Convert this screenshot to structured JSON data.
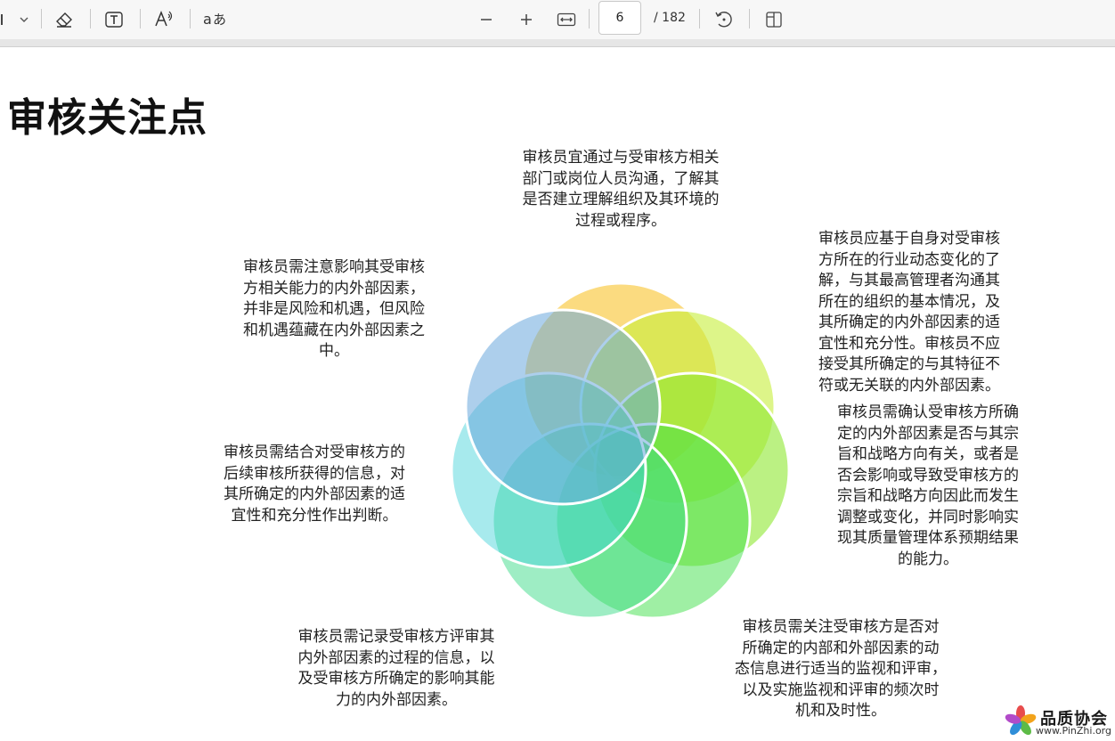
{
  "toolbar": {
    "current_page": "6",
    "total_pages": "/ 182",
    "tools": [
      "draw-dropdown",
      "eraser",
      "text-box",
      "read-aloud",
      "text-options",
      "zoom-out",
      "zoom-in",
      "fit-width",
      "rotate",
      "page-view"
    ]
  },
  "slide": {
    "title": "审核关注点",
    "notes": {
      "top": [
        "审核员宜通过与受审核方相关",
        "部门或岗位人员沟通，了解其",
        "是否建立理解组织及其环境的",
        "过程或程序。"
      ],
      "upper_right": [
        "审核员应基于自身对受审核",
        "方所在的行业动态变化的了",
        "解，与其最高管理者沟通其",
        "所在的组织的基本情况，及",
        "其所确定的内外部因素的适",
        "宜性和充分性。审核员不应",
        "接受其所确定的与其特征不",
        "符或无关联的内外部因素。"
      ],
      "right": [
        "审核员需确认受审核方所确",
        "定的内外部因素是否与其宗",
        "旨和战略方向有关，或者是",
        "否会影响或导致受审核方的",
        "宗旨和战略方向因此而发生",
        "调整或变化，并同时影响实",
        "现其质量管理体系预期结果",
        "的能力。"
      ],
      "lower_right": [
        "审核员需关注受审核方是否对",
        "所确定的内部和外部因素的动",
        "态信息进行适当的监视和评审，",
        "以及实施监视和评审的频次时",
        "机和及时性。"
      ],
      "lower_left": [
        "审核员需记录受审核方评审其",
        "内外部因素的过程的信息，以",
        "及受审核方所确定的影响其能",
        "力的内外部因素。"
      ],
      "left": [
        "审核员需结合对受审核方的",
        "后续审核所获得的信息，对",
        "其所确定的内外部因素的适",
        "宜性和充分性作出判断。"
      ],
      "upper_left": [
        "审核员需注意影响其受审核",
        "方相关能力的内外部因素，",
        "并非是风险和机遇，但风险",
        "和机遇蕴藏在内外部因素之",
        "中。"
      ]
    },
    "venn_colors": [
      "#f9cf55",
      "#c6ef3a",
      "#8ee830",
      "#3fe04a",
      "#3ddc8a",
      "#3bd0d8",
      "#6aa8dc"
    ]
  },
  "watermark": {
    "text": "品质协会",
    "url": "www.PinZhi.org"
  }
}
